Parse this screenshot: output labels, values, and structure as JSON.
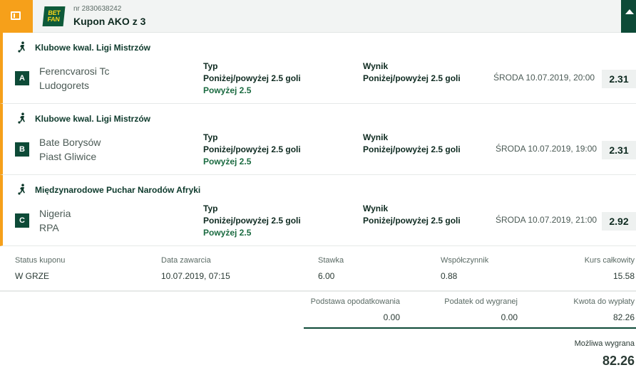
{
  "header": {
    "coupon_nr": "nr 2830638242",
    "title": "Kupon AKO z 3",
    "logo_text_1": "BET",
    "logo_text_2": "FAN"
  },
  "bets": [
    {
      "league": "Klubowe  kwal. Ligi Mistrzów",
      "letter": "A",
      "team1": "Ferencvarosi Tc",
      "team2": "Ludogorets",
      "typ_label": "Typ",
      "typ_market": "Poniżej/powyżej 2.5 goli",
      "typ_pick": "Powyżej 2.5",
      "wynik_label": "Wynik",
      "wynik_market": "Poniżej/powyżej 2.5 goli",
      "date": "ŚRODA 10.07.2019, 20:00",
      "odds": "2.31"
    },
    {
      "league": "Klubowe  kwal. Ligi Mistrzów",
      "letter": "B",
      "team1": "Bate Borysów",
      "team2": "Piast Gliwice",
      "typ_label": "Typ",
      "typ_market": "Poniżej/powyżej 2.5 goli",
      "typ_pick": "Powyżej 2.5",
      "wynik_label": "Wynik",
      "wynik_market": "Poniżej/powyżej 2.5 goli",
      "date": "ŚRODA 10.07.2019, 19:00",
      "odds": "2.31"
    },
    {
      "league": "Międzynarodowe  Puchar Narodów Afryki",
      "letter": "C",
      "team1": "Nigeria",
      "team2": "RPA",
      "typ_label": "Typ",
      "typ_market": "Poniżej/powyżej 2.5 goli",
      "typ_pick": "Powyżej 2.5",
      "wynik_label": "Wynik",
      "wynik_market": "Poniżej/powyżej 2.5 goli",
      "date": "ŚRODA 10.07.2019, 21:00",
      "odds": "2.92"
    }
  ],
  "summary": {
    "status_label": "Status kuponu",
    "status_value": "W GRZE",
    "date_label": "Data zawarcia",
    "date_value": "10.07.2019, 07:15",
    "stake_label": "Stawka",
    "stake_value": "6.00",
    "coef_label": "Współczynnik",
    "coef_value": "0.88",
    "total_odds_label": "Kurs całkowity",
    "total_odds_value": "15.58"
  },
  "calc": {
    "tax_base_label": "Podstawa opodatkowania",
    "tax_base_value": "0.00",
    "tax_label": "Podatek od wygranej",
    "tax_value": "0.00",
    "payout_label": "Kwota do wypłaty",
    "payout_value": "82.26",
    "possible_win_label": "Możliwa wygrana",
    "possible_win_value": "82.26"
  },
  "icons": {
    "back": "back-icon",
    "sport": "football-player-icon",
    "collapse": "chevron-up-icon"
  },
  "colors": {
    "accent_orange": "#f6a01a",
    "brand_dark_green": "#0d4a37",
    "logo_yellow": "#f7d21a"
  }
}
